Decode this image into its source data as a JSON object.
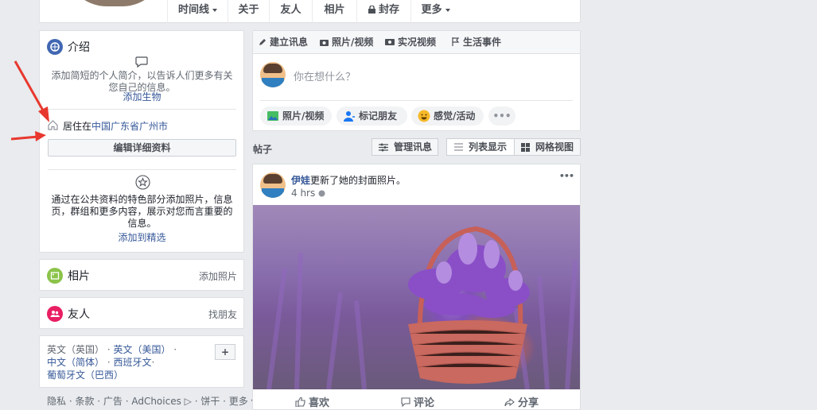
{
  "nav": {
    "tabs": [
      "时间线",
      "关于",
      "友人",
      "相片",
      "封存",
      "更多"
    ]
  },
  "intro": {
    "title": "介绍",
    "bio_prompt": "添加简短的个人简介，以告诉人们更多有关您自己的信息。",
    "add_bio": "添加生物",
    "lives_prefix": "居住在",
    "lives_location": "中国广东省广州市",
    "edit_details": "编辑详细资料",
    "featured_prompt": "通过在公共资料的特色部分添加照片，信息页，群组和更多内容，展示对您而言重要的信息。",
    "add_featured": "添加到精选"
  },
  "photos_card": {
    "title": "相片",
    "action": "添加照片"
  },
  "friends_card": {
    "title": "友人",
    "action": "找朋友"
  },
  "languages": {
    "line1": [
      "英文（英国）",
      "英文（美国）"
    ],
    "line2": [
      "中文（简体）",
      "西班牙文"
    ],
    "line3": [
      "葡萄牙文（巴西）"
    ],
    "add": "+"
  },
  "footer_links": "隐私 · 条款 · 广告 · AdChoices ▷ · 饼干 · 更多 ▾",
  "composer": {
    "tabs": [
      "建立讯息",
      "照片/视频",
      "实况视频",
      "生活事件"
    ],
    "placeholder": "你在想什么？",
    "chips": [
      "照片/视频",
      "标记朋友",
      "感觉/活动",
      "•••"
    ]
  },
  "posts_header": {
    "title": "帖子",
    "manage": "管理讯息",
    "list_view": "列表显示",
    "grid_view": "网格视图"
  },
  "post": {
    "author": "伊娃",
    "action": "更新了她的封面照片。",
    "time": "4 hrs",
    "more": "•••",
    "reactions": [
      "喜欢",
      "评论",
      "分享"
    ]
  },
  "colors": {
    "link": "#365899",
    "arrow": "#e8382e",
    "bg": "#e9ebee"
  }
}
